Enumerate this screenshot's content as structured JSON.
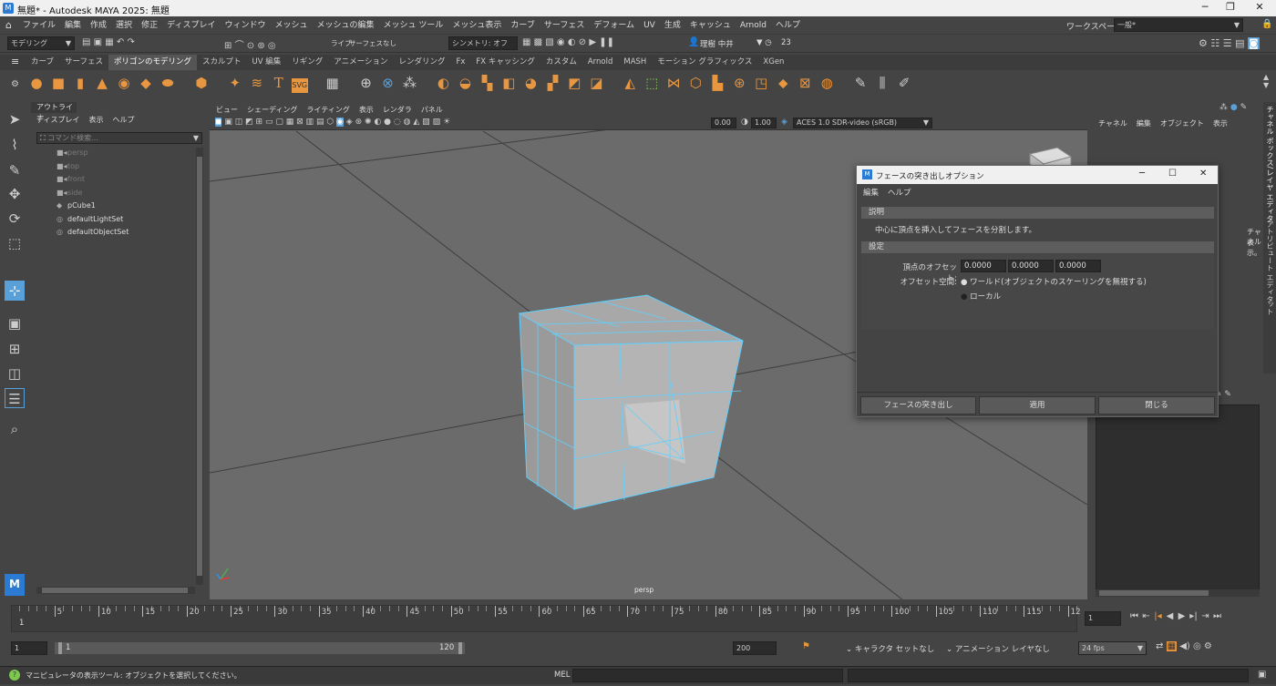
{
  "window": {
    "title": "無題* - Autodesk MAYA 2025: 無題"
  },
  "menubar": {
    "items": [
      "ファイル",
      "編集",
      "作成",
      "選択",
      "修正",
      "ディスプレイ",
      "ウィンドウ",
      "メッシュ",
      "メッシュの編集",
      "メッシュ ツール",
      "メッシュ表示",
      "カーブ",
      "サーフェス",
      "デフォーム",
      "UV",
      "生成",
      "キャッシュ",
      "Arnold",
      "ヘルプ"
    ],
    "workspace_label": "ワークスペース:",
    "workspace_value": "一般*"
  },
  "statusline": {
    "mode": "モデリング",
    "live": "ライブ",
    "live_value": "サーフェスなし",
    "symmetry": "シンメトリ: オフ",
    "user": "理樹 中井",
    "credits": "23"
  },
  "shelf": {
    "tabs": [
      "カーブ",
      "サーフェス",
      "ポリゴンのモデリング",
      "スカルプト",
      "UV 編集",
      "リギング",
      "アニメーション",
      "レンダリング",
      "Fx",
      "FX キャッシング",
      "カスタム",
      "Arnold",
      "MASH",
      "モーション グラフィックス",
      "XGen"
    ],
    "active_tab": "ポリゴンのモデリング"
  },
  "outliner": {
    "title": "アウトライナ",
    "menu": [
      "ディスプレイ",
      "表示",
      "ヘルプ"
    ],
    "search_placeholder": "コマンド検索...",
    "items": [
      {
        "label": "persp",
        "dim": true
      },
      {
        "label": "top",
        "dim": true
      },
      {
        "label": "front",
        "dim": true
      },
      {
        "label": "side",
        "dim": true
      },
      {
        "label": "pCube1",
        "dim": false
      },
      {
        "label": "defaultLightSet",
        "dim": false
      },
      {
        "label": "defaultObjectSet",
        "dim": false
      }
    ]
  },
  "viewport": {
    "menu": [
      "ビュー",
      "シェーディング",
      "ライティング",
      "表示",
      "レンダラ",
      "パネル"
    ],
    "near": "0.00",
    "far": "1.00",
    "colorspace": "ACES 1.0 SDR-video (sRGB)",
    "camera_label": "persp"
  },
  "channelbox": {
    "menu": [
      "チャネル",
      "編集",
      "オブジェクト",
      "表示"
    ],
    "partial_text_1": "チャネル",
    "partial_text_2": "表示。"
  },
  "sidetabs": [
    "チャネル ボックス/レイヤ エディタ",
    "アトリビュート エディタ",
    "モデリング ツールキット"
  ],
  "dialog": {
    "title": "フェースの突き出しオプション",
    "menu": [
      "編集",
      "ヘルプ"
    ],
    "section_description": "説明",
    "description": "中心に頂点を挿入してフェースを分割します。",
    "section_settings": "設定",
    "offset_label": "頂点のオフセット:",
    "offset_values": [
      "0.0000",
      "0.0000",
      "0.0000"
    ],
    "space_label": "オフセット空間:",
    "space_options": [
      "ワールド(オブジェクトのスケーリングを無視する)",
      "ローカル"
    ],
    "buttons": [
      "フェースの突き出し",
      "適用",
      "閉じる"
    ]
  },
  "timeline": {
    "ticks": [
      "5",
      "10",
      "15",
      "20",
      "25",
      "30",
      "35",
      "40",
      "45",
      "50",
      "55",
      "60",
      "65",
      "70",
      "75",
      "80",
      "85",
      "90",
      "95",
      "100",
      "105",
      "110",
      "115",
      "12"
    ],
    "current_start": "1",
    "current_frame": "1"
  },
  "range": {
    "start": "1",
    "inner_start": "1",
    "inner_end": "120",
    "end": "200",
    "character_set": "キャラクタ セットなし",
    "anim_layer": "アニメーション レイヤなし",
    "fps": "24 fps"
  },
  "cmdline": {
    "help": "マニピュレータの表示ツール: オブジェクトを選択してください。",
    "mel": "MEL"
  },
  "colors": {
    "accent": "#e8963f",
    "highlight": "#5aa0d8"
  }
}
